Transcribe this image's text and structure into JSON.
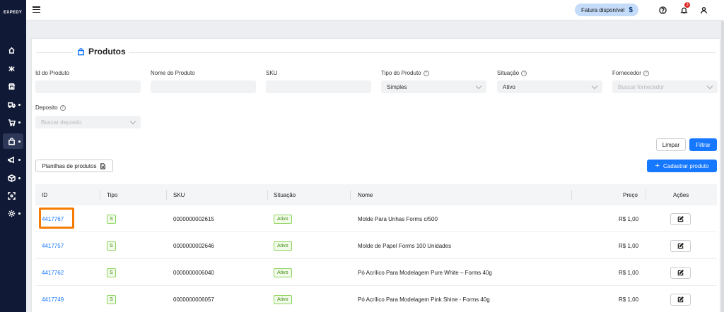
{
  "brand": "EXPEDY",
  "topbar": {
    "fatura_label": "Fatura disponível",
    "fatura_icon": "$",
    "notification_count": "3"
  },
  "page": {
    "title": "Produtos"
  },
  "filters": {
    "id_label": "Id do Produto",
    "id_value": "",
    "nome_label": "Nome do Produto",
    "nome_value": "",
    "sku_label": "SKU",
    "sku_value": "",
    "tipo_label": "Tipo do Produto",
    "tipo_value": "Simples",
    "situacao_label": "Situação",
    "situacao_value": "Ativo",
    "fornecedor_label": "Fornecedor",
    "fornecedor_placeholder": "Buscar fornecedor",
    "deposito_label": "Deposito",
    "deposito_placeholder": "Buscar deposito"
  },
  "actions": {
    "limpar": "Limpar",
    "filtrar": "Filtrar",
    "planilhas": "Planilhas de produtos",
    "cadastrar": "Cadastrar produto"
  },
  "table": {
    "headers": {
      "id": "ID",
      "tipo": "Tipo",
      "sku": "SKU",
      "situacao": "Situação",
      "nome": "Nome",
      "preco": "Preço",
      "acoes": "Ações"
    },
    "rows": [
      {
        "id": "4417767",
        "tipo": "S",
        "sku": "0000000002615",
        "situacao": "Ativo",
        "nome": "Molde Para Unhas Forms c/500",
        "preco": "R$ 1,00"
      },
      {
        "id": "4417757",
        "tipo": "S",
        "sku": "0000000002646",
        "situacao": "Ativo",
        "nome": "Molde de Papel Forms 100 Unidades",
        "preco": "R$ 1,00"
      },
      {
        "id": "4417762",
        "tipo": "S",
        "sku": "0000000006040",
        "situacao": "Ativo",
        "nome": "Pó Acrílico Para Modelagem Pure White – Forms 40g",
        "preco": "R$ 1,00"
      },
      {
        "id": "4417749",
        "tipo": "S",
        "sku": "0000000006057",
        "situacao": "Ativo",
        "nome": "Pó Acrílico Para Modelagem Pink Shine - Forms 40g",
        "preco": "R$ 1,00"
      }
    ]
  },
  "colors": {
    "sidebar": "#101935",
    "primary": "#1677ff",
    "highlight": "#f57c00",
    "tag_green": "#3e8e12"
  }
}
